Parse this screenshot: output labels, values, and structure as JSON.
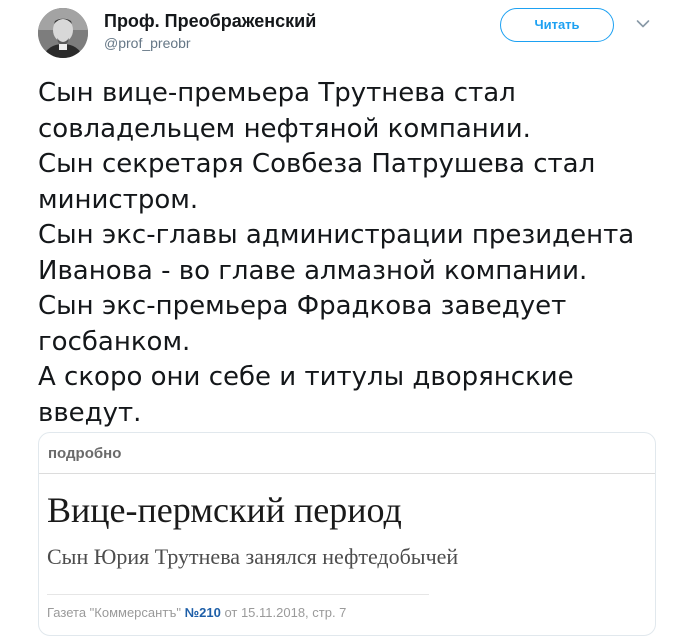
{
  "author": {
    "display_name": "Проф. Преображенский",
    "handle": "@prof_preobr"
  },
  "actions": {
    "follow_label": "Читать",
    "more_icon": "chevron-down-icon"
  },
  "tweet": {
    "lines": [
      "Сын вице-премьера Трутнева стал",
      "совладельцем нефтяной компании.",
      "Сын секретаря Совбеза Патрушева стал",
      "министром.",
      "Сын экс-главы администрации президента",
      "Иванова - во главе алмазной компании.",
      "Сын экс-премьера Фрадкова заведует",
      "госбанком.",
      "А скоро они себе и титулы дворянские",
      "введут."
    ]
  },
  "card": {
    "section_label": "подробно",
    "headline": "Вице-пермский период",
    "subheadline": "Сын Юрия Трутнева занялся нефтедобычей",
    "source_prefix": "Газета \"Коммерсантъ\" ",
    "source_number_sign": "№",
    "source_issue": "210",
    "source_suffix": " от 15.11.2018, стр. 7"
  },
  "colors": {
    "accent": "#1da1f2",
    "text": "#14171a",
    "muted": "#657786",
    "card_border": "#e1e8ed"
  }
}
